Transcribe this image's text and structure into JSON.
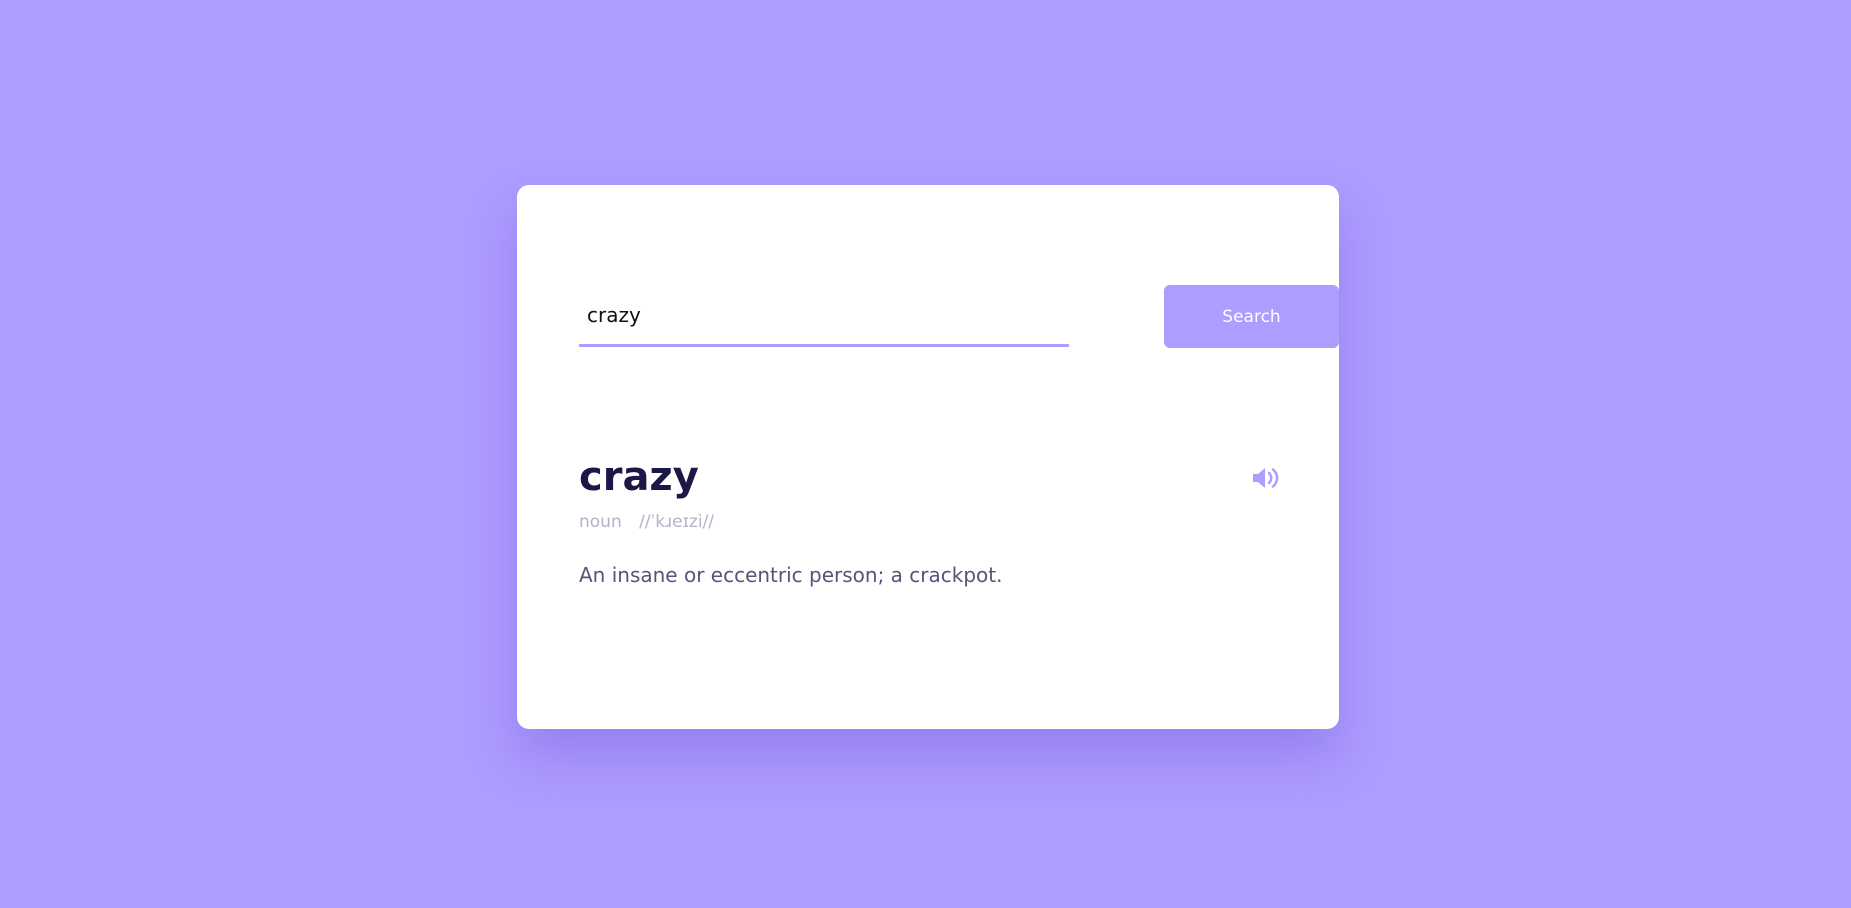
{
  "search": {
    "value": "crazy",
    "button_label": "Search"
  },
  "result": {
    "word": "crazy",
    "part_of_speech": "noun",
    "phonetic": "//ˈkɹeɪzi//",
    "definition": "An insane or eccentric person; a crackpot.",
    "audio_icon": "speaker-icon"
  },
  "colors": {
    "background": "#ae9cff",
    "card": "#ffffff",
    "accent": "#ae9cff",
    "word": "#1b1747",
    "muted": "#b4b2c8",
    "definition": "#55557a"
  }
}
